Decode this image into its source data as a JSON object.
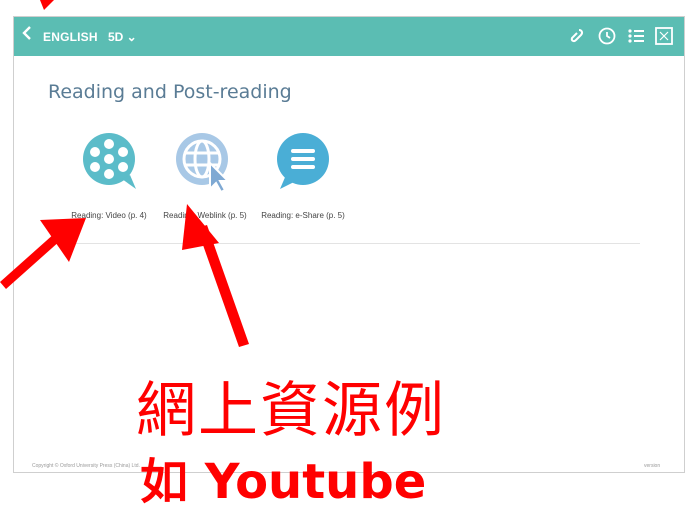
{
  "topbar": {
    "back_icon": "chevron-left-icon",
    "course": "ENGLISH",
    "level": "5D ⌄",
    "tools": [
      "link-icon",
      "clock-icon",
      "list-icon",
      "expand-icon"
    ]
  },
  "section": {
    "title": "Reading and Post-reading"
  },
  "resources": [
    {
      "icon": "video-reel-icon",
      "label": "Reading: Video (p. 4)",
      "color": "#5bbcc9"
    },
    {
      "icon": "weblink-globe-icon",
      "label": "Reading: Weblink (p. 5)",
      "color": "#a8c8e6"
    },
    {
      "icon": "eshare-chat-icon",
      "label": "Reading: e-Share (p. 5)",
      "color": "#4aaed6"
    }
  ],
  "footer": {
    "copyright": "Copyright © Oxford University Press (China) Ltd.",
    "version": "version"
  },
  "annotation": {
    "text": "網上資源例",
    "bottom_text": "如 Youtube",
    "color": "#ff0000"
  }
}
